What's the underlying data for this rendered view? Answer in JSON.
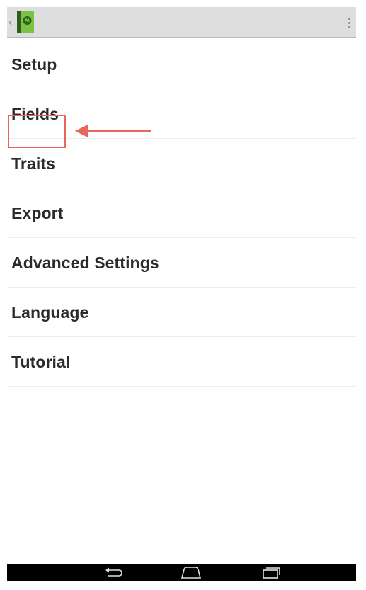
{
  "action_bar": {
    "app_icon": "green-book-app-icon",
    "up_icon": "chevron-left-icon",
    "overflow_icon": "overflow-menu-icon"
  },
  "menu": {
    "items": [
      {
        "label": "Setup"
      },
      {
        "label": "Fields"
      },
      {
        "label": "Traits"
      },
      {
        "label": "Export"
      },
      {
        "label": "Advanced Settings"
      },
      {
        "label": "Language"
      },
      {
        "label": "Tutorial"
      }
    ]
  },
  "annotation": {
    "highlighted_item": "Traits",
    "color": "#e8675a",
    "arrow_icon": "arrow-left-icon"
  },
  "nav_bar": {
    "back_icon": "back-icon",
    "home_icon": "home-icon",
    "recents_icon": "recents-icon"
  }
}
